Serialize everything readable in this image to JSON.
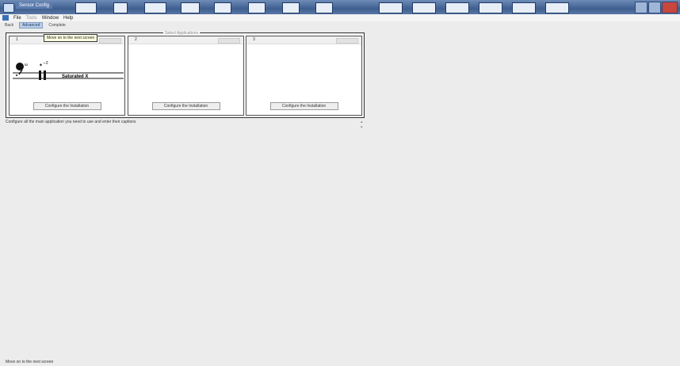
{
  "window": {
    "title": "Sensor Config"
  },
  "menu": {
    "items": [
      "File",
      "Tools",
      "Window",
      "Help"
    ]
  },
  "toolbar": {
    "tabs": [
      "Back",
      "Advanced",
      "Complete"
    ],
    "active_index": 1
  },
  "panels_group_title": "Select Applications",
  "tooltip": "Move on to the next screen",
  "panels": [
    {
      "number": "1",
      "button_label": "Configure the Installation"
    },
    {
      "number": "2",
      "button_label": "Configure the Installation"
    },
    {
      "number": "3",
      "button_label": "Configure the Installation"
    }
  ],
  "preview": {
    "label": "Saturated X"
  },
  "message": "Configure all the main application you need to use and enter their captions",
  "status": "Move on to the next screen",
  "colors": {
    "titlebar": "#3f5f8f",
    "accent": "#bcd0ea",
    "close": "#c9463d"
  },
  "icons": {
    "app": "app-icon",
    "minimize": "minimize-icon",
    "maximize": "maximize-icon",
    "close": "close-icon"
  }
}
